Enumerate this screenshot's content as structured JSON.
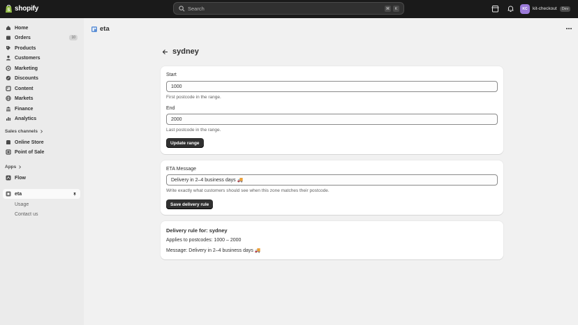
{
  "topbar": {
    "brand": "shopify",
    "search_placeholder": "Search",
    "kbd_modifier": "⌘",
    "kbd_key": "K",
    "avatar_initials": "KC",
    "store_name": "kit-checkout",
    "store_badge": "Dev"
  },
  "sidebar": {
    "items": [
      {
        "label": "Home",
        "icon": "home-icon"
      },
      {
        "label": "Orders",
        "icon": "orders-icon",
        "count": "10"
      },
      {
        "label": "Products",
        "icon": "tag-icon"
      },
      {
        "label": "Customers",
        "icon": "person-icon"
      },
      {
        "label": "Marketing",
        "icon": "target-icon"
      },
      {
        "label": "Discounts",
        "icon": "discount-icon"
      },
      {
        "label": "Content",
        "icon": "content-icon"
      },
      {
        "label": "Markets",
        "icon": "globe-icon"
      },
      {
        "label": "Finance",
        "icon": "bank-icon"
      },
      {
        "label": "Analytics",
        "icon": "chart-icon"
      }
    ],
    "sales_channels_label": "Sales channels",
    "sales_channels": [
      {
        "label": "Online Store",
        "icon": "store-icon"
      },
      {
        "label": "Point of Sale",
        "icon": "pos-icon"
      }
    ],
    "apps_label": "Apps",
    "apps": [
      {
        "label": "Flow",
        "icon": "flow-icon"
      }
    ],
    "active_app": {
      "label": "eta",
      "icon": "app-icon"
    },
    "sub_items": [
      "Usage",
      "Contact us"
    ]
  },
  "app": {
    "title": "eta"
  },
  "page": {
    "title": "sydney"
  },
  "range_card": {
    "start_label": "Start",
    "start_value": "1000",
    "start_help": "First postcode in the range.",
    "end_label": "End",
    "end_value": "2000",
    "end_help": "Last postcode in the range.",
    "button": "Update range"
  },
  "message_card": {
    "label": "ETA Message",
    "value": "Delivery in 2–4 business days 🚚",
    "help": "Write exactly what customers should see when this zone matches their postcode.",
    "button": "Save delivery rule"
  },
  "rule_card": {
    "title": "Delivery rule for: sydney",
    "postcodes": "Applies to postcodes: 1000 – 2000",
    "message": "Message: Delivery in 2–4 business days 🚚"
  },
  "colors": {
    "topbar": "#1a1a1a",
    "sidebar": "#ebebeb",
    "background": "#f1f1f1",
    "primary_button": "#303030",
    "avatar": "#9b7ad8"
  }
}
